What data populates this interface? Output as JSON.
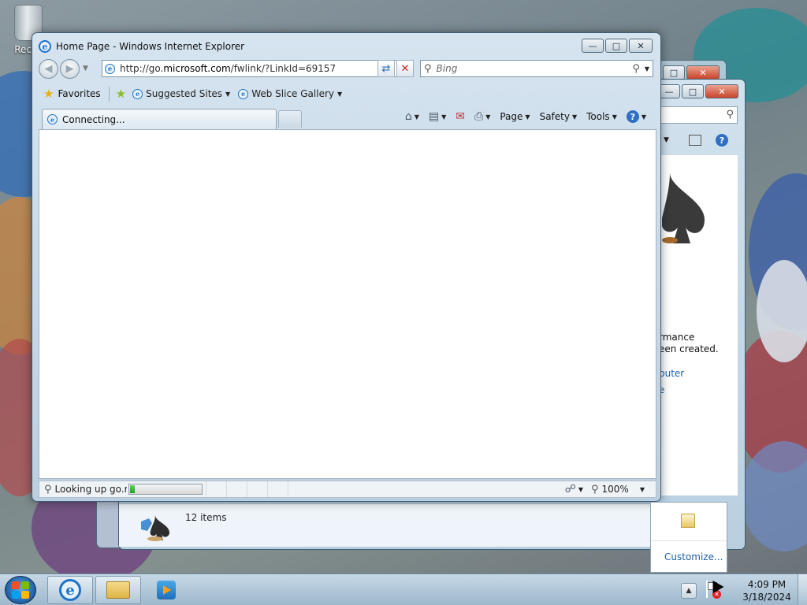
{
  "desktop": {
    "recycle_bin_label": "Recyc"
  },
  "background_window": {
    "text_line1": "rmance",
    "text_line2": "een created.",
    "link1": "puter",
    "link2": "e",
    "status_count": "12 items"
  },
  "ie": {
    "title": "Home Page - Windows Internet Explorer",
    "address": {
      "prefix": "http://go.",
      "domain": "microsoft.com",
      "suffix": "/fwlink/?LinkId=69157"
    },
    "search_placeholder": "Bing",
    "favorites_label": "Favorites",
    "suggested_sites_label": "Suggested Sites",
    "web_slice_label": "Web Slice Gallery",
    "tab_label": "Connecting...",
    "commands": {
      "page": "Page",
      "safety": "Safety",
      "tools": "Tools"
    },
    "status_text": "Looking up go.mici",
    "progress_fraction": 0.06,
    "zoom": "100%"
  },
  "tray_popup": {
    "customize_label": "Customize..."
  },
  "taskbar": {
    "time": "4:09 PM",
    "date": "3/18/2024"
  },
  "colors": {
    "accent": "#1e73c8",
    "progress_green": "#1ea01e",
    "close_red": "#c8442a"
  }
}
